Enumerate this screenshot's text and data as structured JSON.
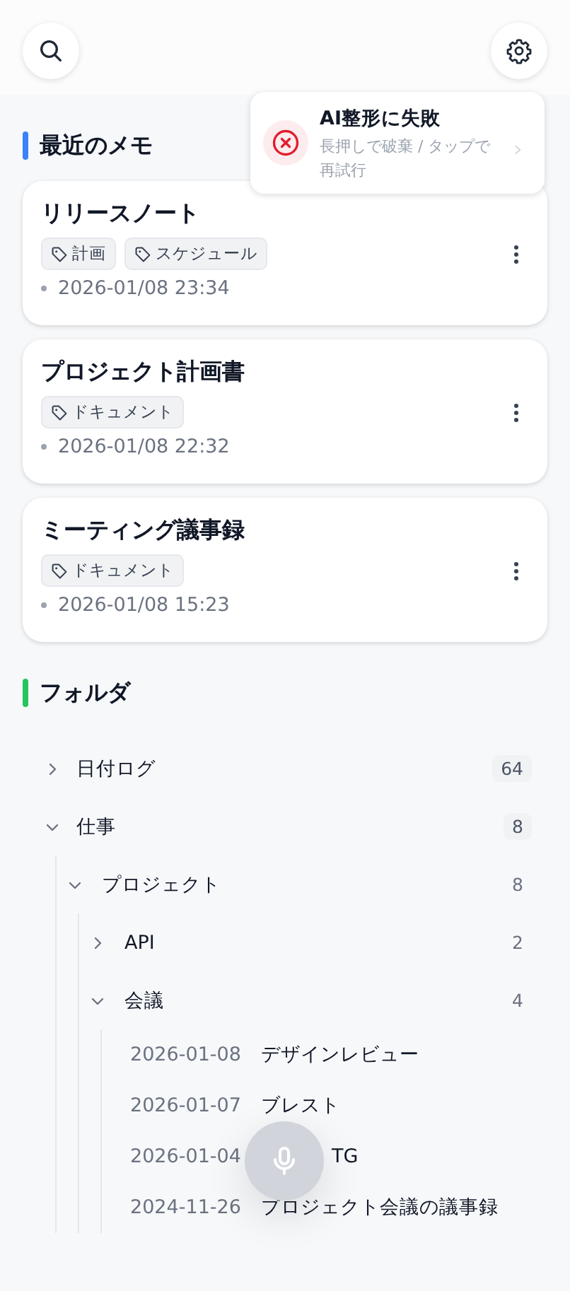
{
  "toast": {
    "title": "AI整形に失敗",
    "message": "長押しで破棄 / タップで再試行"
  },
  "recent": {
    "heading": "最近のメモ",
    "memos": [
      {
        "title": "リリースノート",
        "tags": [
          "計画",
          "スケジュール"
        ],
        "timestamp": "2026-01/08 23:34"
      },
      {
        "title": "プロジェクト計画書",
        "tags": [
          "ドキュメント"
        ],
        "timestamp": "2026-01/08 22:32"
      },
      {
        "title": "ミーティング議事録",
        "tags": [
          "ドキュメント"
        ],
        "timestamp": "2026-01/08 15:23"
      }
    ]
  },
  "folders": {
    "heading": "フォルダ",
    "tree": [
      {
        "kind": "folder",
        "label": "日付ログ",
        "count": "64",
        "expanded": false
      },
      {
        "kind": "folder",
        "label": "仕事",
        "count": "8",
        "expanded": true,
        "children": [
          {
            "kind": "folder",
            "label": "プロジェクト",
            "count": "8",
            "expanded": true,
            "children": [
              {
                "kind": "folder",
                "label": "API",
                "count": "2",
                "expanded": false
              },
              {
                "kind": "folder",
                "label": "会議",
                "count": "4",
                "expanded": true,
                "children": [
                  {
                    "kind": "note",
                    "date": "2026-01-08",
                    "title": "デザインレビュー"
                  },
                  {
                    "kind": "note",
                    "date": "2026-01-07",
                    "title": "ブレスト"
                  },
                  {
                    "kind": "note",
                    "date": "2026-01-04",
                    "title": "TG",
                    "partly_covered": true
                  },
                  {
                    "kind": "note",
                    "date": "2024-11-26",
                    "title": "プロジェクト会議の議事録"
                  }
                ]
              }
            ]
          }
        ]
      }
    ]
  }
}
